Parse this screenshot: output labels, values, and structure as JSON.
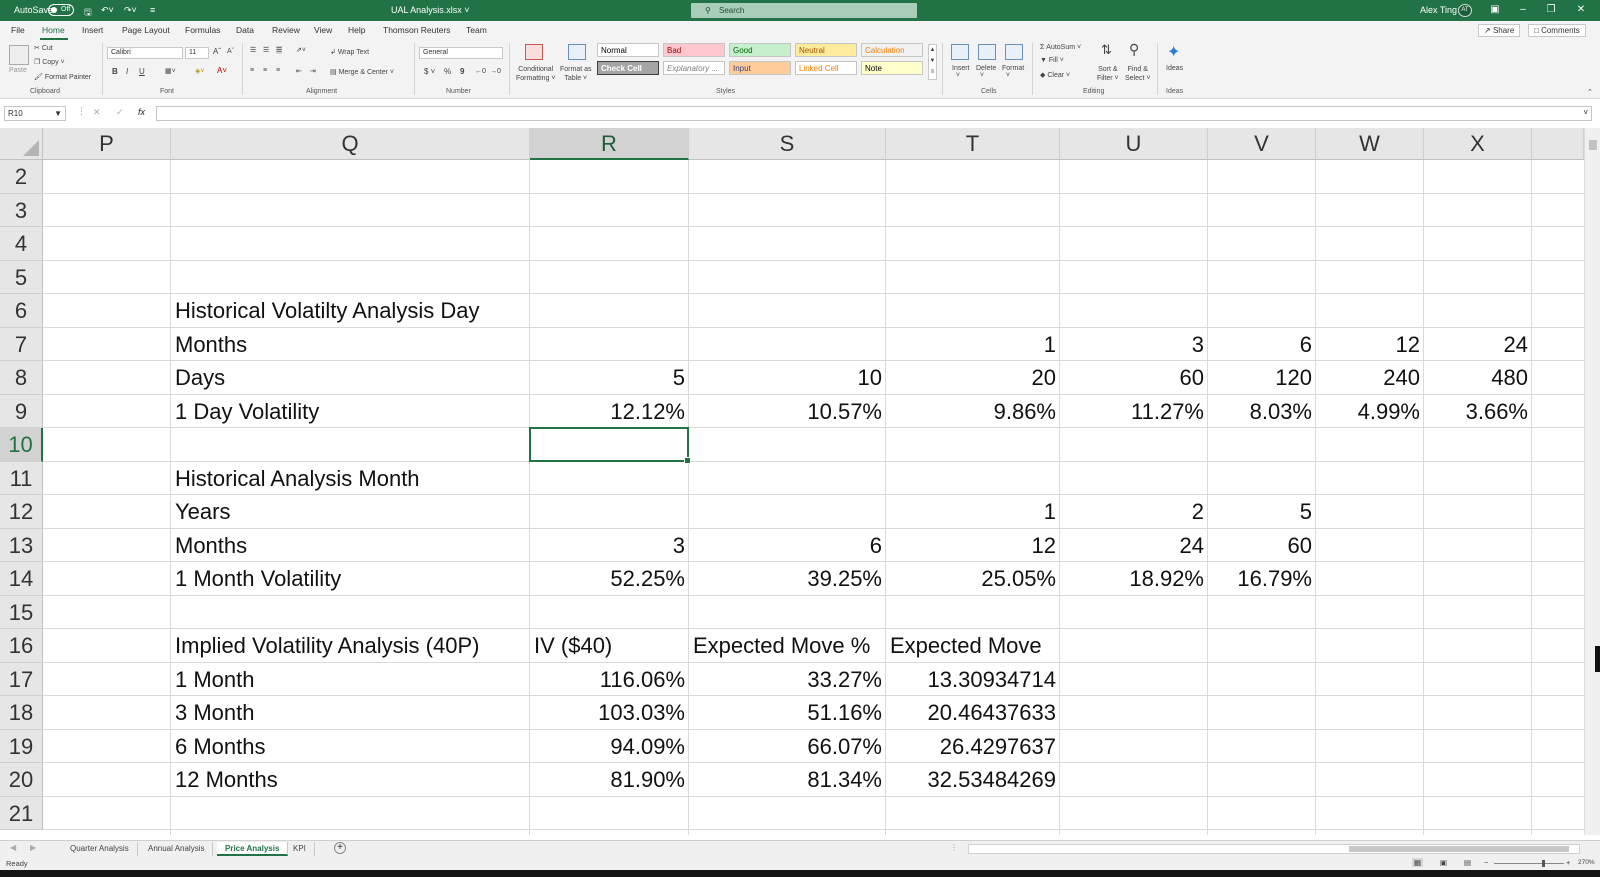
{
  "titlebar": {
    "autosave_label": "AutoSave",
    "autosave_state": "Off",
    "filename": "UAL Analysis.xlsx",
    "search_placeholder": "Search",
    "user_name": "Alex Ting",
    "user_initials": "AT"
  },
  "tabs": [
    "File",
    "Home",
    "Insert",
    "Page Layout",
    "Formulas",
    "Data",
    "Review",
    "View",
    "Help",
    "Thomson Reuters",
    "Team"
  ],
  "tabs_right": {
    "share": "Share",
    "comments": "Comments"
  },
  "ribbon": {
    "clipboard": {
      "paste": "Paste",
      "cut": "Cut",
      "copy": "Copy",
      "format_painter": "Format Painter",
      "label": "Clipboard"
    },
    "font": {
      "name": "Calibri",
      "size": "11",
      "bold": "B",
      "italic": "I",
      "underline": "U",
      "label": "Font"
    },
    "alignment": {
      "wrap_text": "Wrap Text",
      "merge_center": "Merge & Center",
      "label": "Alignment"
    },
    "number": {
      "format": "General",
      "currency": "$",
      "percent": "%",
      "comma": "9",
      "label": "Number"
    },
    "conditional_formatting": [
      "Conditional",
      "Formatting"
    ],
    "format_as_table": [
      "Format as",
      "Table"
    ],
    "styles": {
      "row1": [
        {
          "name": "Normal",
          "bg": "#ffffff",
          "fg": "#000000"
        },
        {
          "name": "Bad",
          "bg": "#ffc7ce",
          "fg": "#9c0006"
        },
        {
          "name": "Good",
          "bg": "#c6efce",
          "fg": "#006100"
        },
        {
          "name": "Neutral",
          "bg": "#ffeb9c",
          "fg": "#9c5700"
        },
        {
          "name": "Calculation",
          "bg": "#f2f2f2",
          "fg": "#fa7d00"
        }
      ],
      "row2": [
        {
          "name": "Check Cell",
          "bg": "#a5a5a5",
          "fg": "#ffffff"
        },
        {
          "name": "Explanatory ...",
          "bg": "#ffffff",
          "fg": "#7f7f7f"
        },
        {
          "name": "Input",
          "bg": "#ffcc99",
          "fg": "#3f3f76"
        },
        {
          "name": "Linked Cell",
          "bg": "#ffffff",
          "fg": "#fa7d00"
        },
        {
          "name": "Note",
          "bg": "#ffffcc",
          "fg": "#000000"
        }
      ],
      "label": "Styles"
    },
    "cells": {
      "insert": "Insert",
      "delete": "Delete",
      "format": "Format",
      "label": "Cells"
    },
    "editing": {
      "autosum": "AutoSum",
      "fill": "Fill",
      "clear": "Clear",
      "sort_filter": [
        "Sort &",
        "Filter"
      ],
      "find_select": [
        "Find &",
        "Select"
      ],
      "label": "Editing"
    },
    "ideas": {
      "button": "Ideas",
      "label": "Ideas"
    }
  },
  "formula_bar": {
    "name_box": "R10",
    "fx": "fx",
    "content": ""
  },
  "columns": [
    "P",
    "Q",
    "R",
    "S",
    "T",
    "U",
    "V",
    "W",
    "X"
  ],
  "rows": [
    "2",
    "3",
    "4",
    "5",
    "6",
    "7",
    "8",
    "9",
    "10",
    "11",
    "12",
    "13",
    "14",
    "15",
    "16",
    "17",
    "18",
    "19",
    "20",
    "21"
  ],
  "selected_cell": "R10",
  "cells": {
    "Q6": "Historical Volatilty Analysis Day",
    "Q7": "Months",
    "T7": "1",
    "U7": "3",
    "V7": "6",
    "W7": "12",
    "X7": "24",
    "Q8": "Days",
    "R8": "5",
    "S8": "10",
    "T8": "20",
    "U8": "60",
    "V8": "120",
    "W8": "240",
    "X8": "480",
    "Q9": "1 Day Volatility",
    "R9": "12.12%",
    "S9": "10.57%",
    "T9": "9.86%",
    "U9": "11.27%",
    "V9": "8.03%",
    "W9": "4.99%",
    "X9": "3.66%",
    "Q11": "Historical Analysis Month",
    "Q12": "Years",
    "T12": "1",
    "U12": "2",
    "V12": "5",
    "Q13": "Months",
    "R13": "3",
    "S13": "6",
    "T13": "12",
    "U13": "24",
    "V13": "60",
    "Q14": "1 Month Volatility",
    "R14": "52.25%",
    "S14": "39.25%",
    "T14": "25.05%",
    "U14": "18.92%",
    "V14": "16.79%",
    "Q16": "Implied Volatility Analysis (40P)",
    "R16": "IV ($40)",
    "S16": "Expected Move %",
    "T16": "Expected Move",
    "Q17": "1 Month",
    "R17": "116.06%",
    "S17": "33.27%",
    "T17": "13.30934714",
    "Q18": "3 Month",
    "R18": "103.03%",
    "S18": "51.16%",
    "T18": "20.46437633",
    "Q19": "6 Months",
    "R19": "94.09%",
    "S19": "66.07%",
    "T19": "26.4297637",
    "Q20": "12 Months",
    "R20": "81.90%",
    "S20": "81.34%",
    "T20": "32.53484269"
  },
  "left_aligned_cells": [
    "Q6",
    "Q7",
    "Q8",
    "Q9",
    "Q11",
    "Q12",
    "Q13",
    "Q14",
    "Q16",
    "Q17",
    "Q18",
    "Q19",
    "Q20",
    "R16",
    "S16",
    "T16"
  ],
  "sheet_tabs": [
    "Quarter Analysis",
    "Annual Analysis",
    "Price Analysis",
    "KPI"
  ],
  "active_sheet": "Price Analysis",
  "status": {
    "ready": "Ready",
    "zoom": "270%"
  },
  "colors": {
    "excel_green": "#217346",
    "grid_line": "#dadada",
    "header_bg": "#e6e6e6"
  }
}
